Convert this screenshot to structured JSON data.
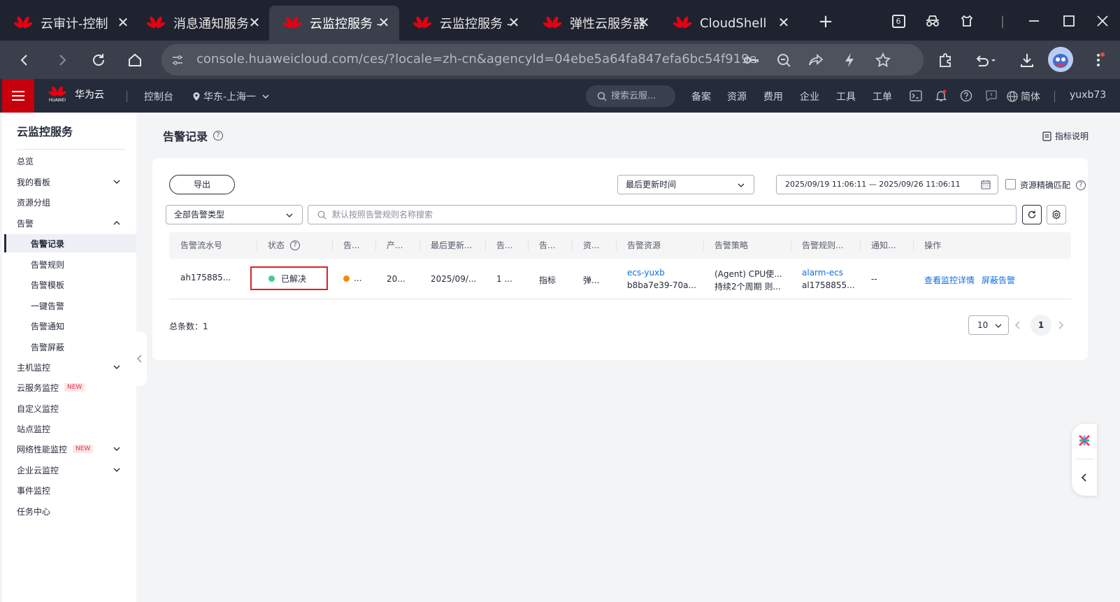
{
  "browser": {
    "tabs": [
      {
        "title": "云审计-控制",
        "active": false
      },
      {
        "title": "消息通知服务",
        "active": false
      },
      {
        "title": "云监控服务 -",
        "active": true
      },
      {
        "title": "云监控服务 -",
        "active": false
      },
      {
        "title": "弹性云服务器",
        "active": false
      },
      {
        "title": "CloudShell",
        "active": false
      }
    ],
    "tab_count": "6",
    "url": "console.huaweicloud.com/ces/?locale=zh-cn&agencyId=04ebe5a64fa847efa6bc54f919e9..."
  },
  "header": {
    "brand": "华为云",
    "logo_text": "HUAWEI",
    "console": "控制台",
    "region": "华东-上海一",
    "search_placeholder": "搜索云服...",
    "nav": [
      "备案",
      "资源",
      "费用",
      "企业",
      "工具",
      "工单"
    ],
    "language": "简体",
    "username": "yuxb73",
    "accent": "#c7000b"
  },
  "sidebar": {
    "title": "云监控服务",
    "items": [
      {
        "label": "总览"
      },
      {
        "label": "我的看板"
      },
      {
        "label": "资源分组"
      },
      {
        "label": "告警"
      },
      {
        "label": "告警记录"
      },
      {
        "label": "告警规则"
      },
      {
        "label": "告警模板"
      },
      {
        "label": "一键告警"
      },
      {
        "label": "告警通知"
      },
      {
        "label": "告警屏蔽"
      },
      {
        "label": "主机监控"
      },
      {
        "label": "云服务监控",
        "badge": "NEW"
      },
      {
        "label": "自定义监控"
      },
      {
        "label": "站点监控"
      },
      {
        "label": "网络性能监控",
        "badge": "NEW"
      },
      {
        "label": "企业云监控"
      },
      {
        "label": "事件监控"
      },
      {
        "label": "任务中心"
      }
    ]
  },
  "main": {
    "title": "告警记录",
    "metric_help": "指标说明",
    "export": "导出",
    "sort_select": "最后更新时间",
    "date_range": "2025/09/19 11:06:11 — 2025/09/26 11:06:11",
    "exact_match": "资源精确匹配",
    "type_select": "全部告警类型",
    "search_placeholder": "默认按照告警规则名称搜索",
    "columns": [
      "告警流水号",
      "状态",
      "告...",
      "产...",
      "最后更新...",
      "告...",
      "告...",
      "资...",
      "告警资源",
      "告警策略",
      "告警规则...",
      "通知...",
      "操作"
    ],
    "row": {
      "serial": "ah175885...",
      "status": "已解决",
      "status_color": "#3ecf8e",
      "level_color": "#f28b00",
      "level": "...",
      "produced": "20...",
      "updated": "2025/09/...",
      "count": "1 ...",
      "alarm_type": "指标",
      "resource_type": "弹...",
      "resource_name": "ecs-yuxb",
      "resource_id": "b8ba7e39-70a...",
      "policy_1": "(Agent) CPU使...",
      "policy_2": "持续2个周期 则...",
      "rule_name": "alarm-ecs",
      "rule_id": "al1758855...",
      "notify": "--",
      "action_detail": "查看监控详情",
      "action_mask": "屏蔽告警"
    },
    "total": "总条数：1",
    "page_size": "10",
    "page": "1"
  }
}
